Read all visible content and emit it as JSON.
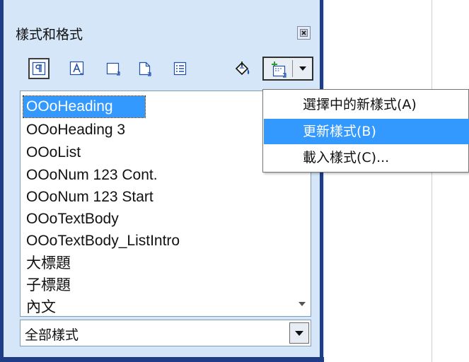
{
  "panel": {
    "title": "樣式和格式",
    "toolbar": {
      "buttons": [
        {
          "name": "paragraph-styles",
          "icon": "paragraph-styles-icon",
          "pressed": true
        },
        {
          "name": "character-styles",
          "icon": "character-styles-icon",
          "pressed": false
        },
        {
          "name": "frame-styles",
          "icon": "frame-styles-icon",
          "pressed": false
        },
        {
          "name": "page-styles",
          "icon": "page-styles-icon",
          "pressed": false
        },
        {
          "name": "list-styles",
          "icon": "list-styles-icon",
          "pressed": false
        },
        {
          "name": "fill-format-mode",
          "icon": "paint-bucket-icon",
          "pressed": false
        },
        {
          "name": "new-style-from-selection",
          "icon": "new-style-icon",
          "pressed": true
        }
      ]
    },
    "list": {
      "items": [
        "OOoHeading",
        "OOoHeading 3",
        "OOoList",
        "OOoNum 123 Cont.",
        "OOoNum 123 Start",
        "OOoTextBody",
        "OOoTextBody_ListIntro",
        "大標題",
        "子標題",
        "內文"
      ],
      "selected_index": 0
    },
    "filter": {
      "value": "全部樣式"
    }
  },
  "menu": {
    "items": [
      {
        "label": "選擇中的新樣式(A)"
      },
      {
        "label": "更新樣式(B)"
      },
      {
        "label": "載入樣式(C)..."
      }
    ],
    "highlighted_index": 1
  },
  "colors": {
    "panel_bg": "#d4e6f7",
    "panel_border": "#1f3c86",
    "selection": "#3399ff"
  }
}
